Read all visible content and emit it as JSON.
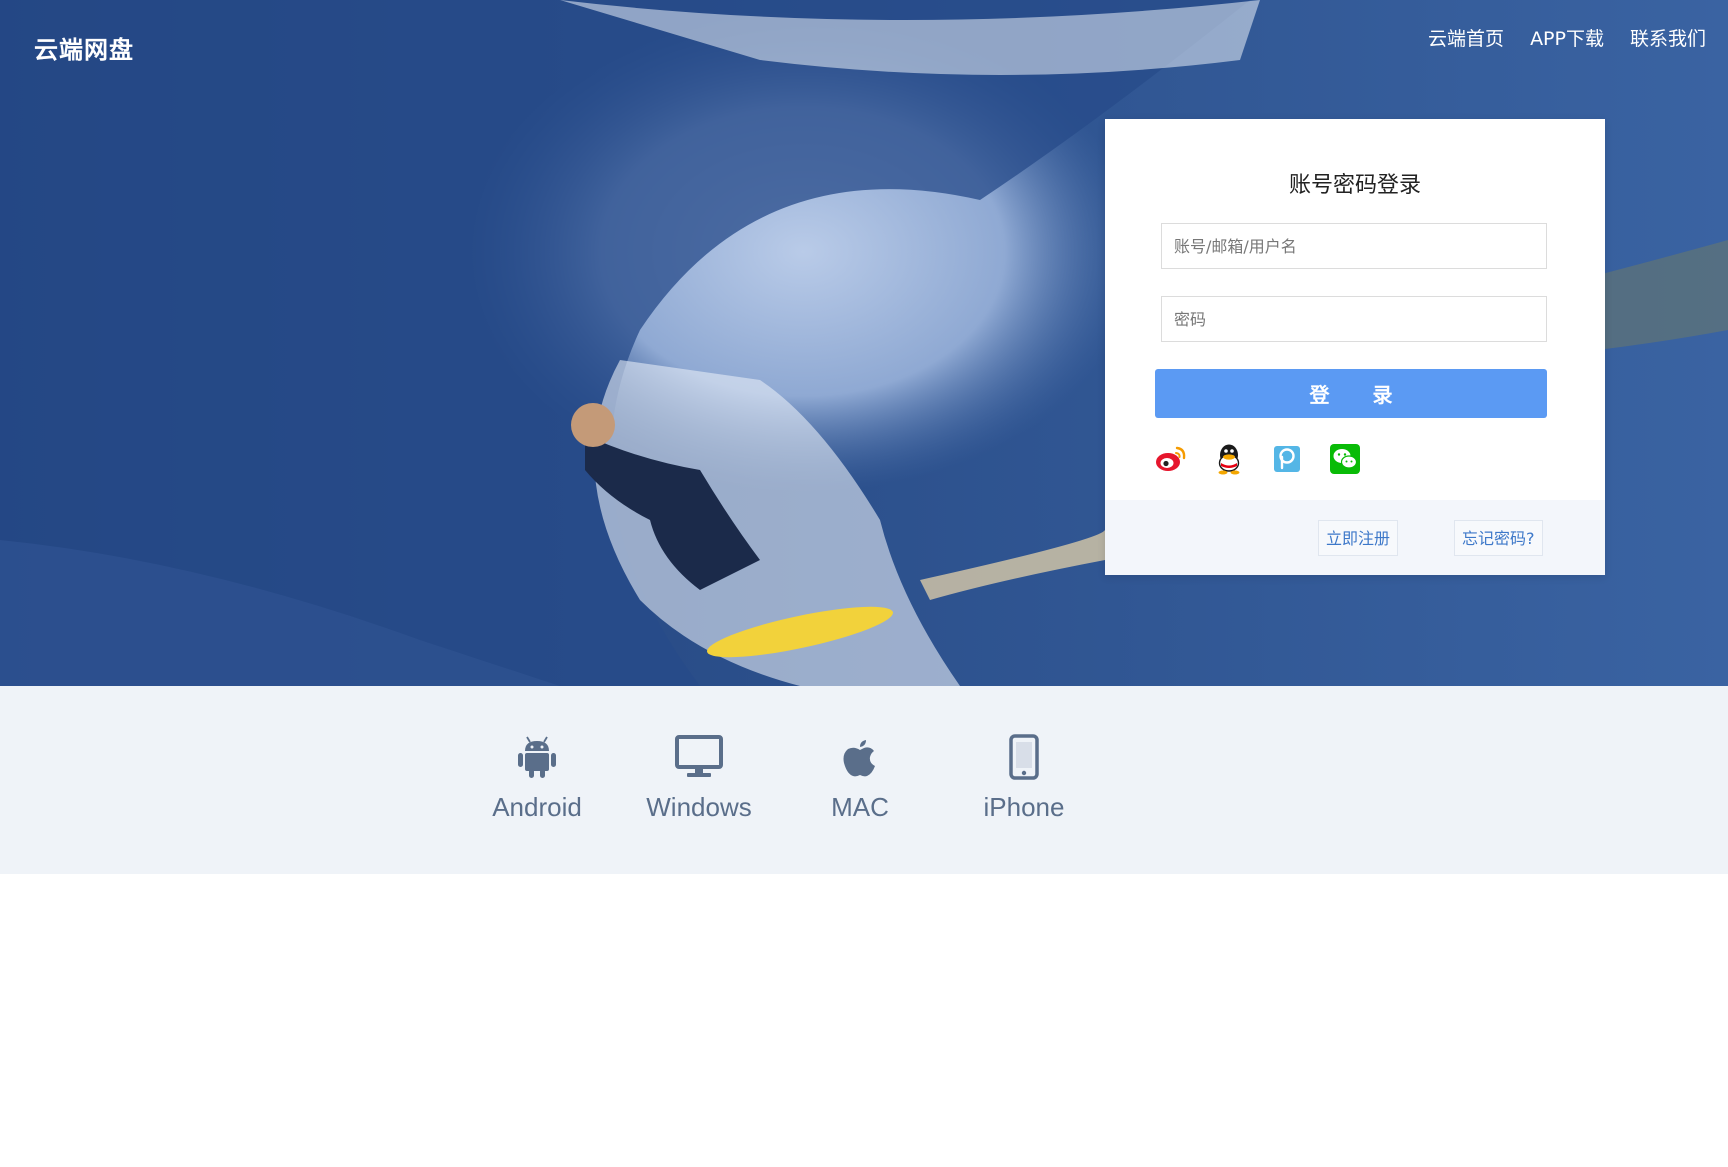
{
  "header": {
    "logo": "云端网盘",
    "nav": [
      {
        "label": "云端首页"
      },
      {
        "label": "APP下载"
      },
      {
        "label": "联系我们"
      }
    ]
  },
  "login": {
    "title": "账号密码登录",
    "username_placeholder": "账号/邮箱/用户名",
    "password_placeholder": "密码",
    "submit_label": "登 录",
    "social": [
      {
        "icon": "weibo-icon"
      },
      {
        "icon": "qq-icon"
      },
      {
        "icon": "p-icon"
      },
      {
        "icon": "wechat-icon"
      }
    ],
    "register_label": "立即注册",
    "forgot_label": "忘记密码?"
  },
  "downloads": {
    "items": [
      {
        "label": "Android",
        "icon": "android-icon"
      },
      {
        "label": "Windows",
        "icon": "monitor-icon"
      },
      {
        "label": "MAC",
        "icon": "apple-icon"
      },
      {
        "label": "iPhone",
        "icon": "phone-icon"
      }
    ]
  },
  "colors": {
    "primary_button": "#5b9af3",
    "link": "#3d78c9",
    "download_bar_bg": "#eff3f8",
    "download_text": "#5a6e8a"
  }
}
